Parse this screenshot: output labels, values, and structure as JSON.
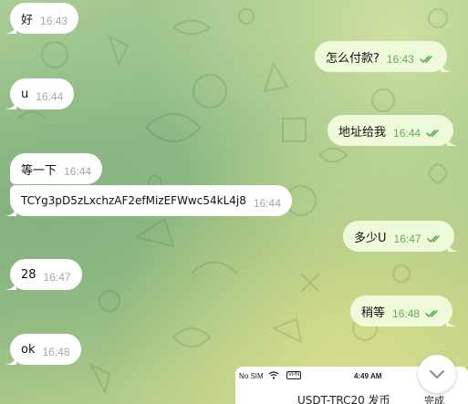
{
  "messages": [
    {
      "side": "in",
      "text": "好",
      "time": "16:43"
    },
    {
      "side": "out",
      "text": "怎么付款?",
      "time": "16:43"
    },
    {
      "side": "in",
      "text": "u",
      "time": "16:44"
    },
    {
      "side": "out",
      "text": "地址给我",
      "time": "16:44"
    },
    {
      "side": "in",
      "text": "等一下",
      "time": "16:44"
    },
    {
      "side": "in",
      "text": "TCYg3pD5zLxchzAF2efMizEFWwc54kL4j8",
      "time": "16:44"
    },
    {
      "side": "out",
      "text": "多少U",
      "time": "16:47"
    },
    {
      "side": "in",
      "text": "28",
      "time": "16:47"
    },
    {
      "side": "out",
      "text": "稍等",
      "time": "16:48"
    },
    {
      "side": "in",
      "text": "ok",
      "time": "16:48"
    }
  ],
  "attachment_preview": {
    "status_carrier": "No SIM",
    "status_vpn": "VPN",
    "status_time": "4:49 AM",
    "title": "USDT-TRC20 发币",
    "done_label": "完成"
  },
  "colors": {
    "incoming_bubble": "#ffffff",
    "outgoing_bubble": "#eefad9",
    "outgoing_time": "#5fae5a",
    "incoming_time": "#a6a6a6"
  },
  "icons": {
    "scroll_down": "chevron-down-icon",
    "read_receipt": "double-check-icon"
  }
}
